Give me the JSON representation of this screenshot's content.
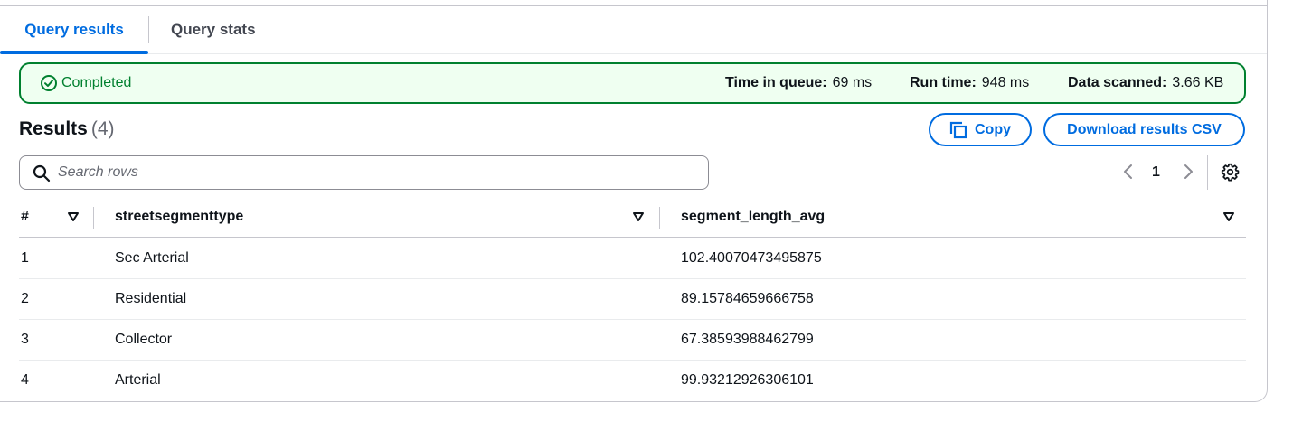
{
  "tabs": [
    {
      "label": "Query results",
      "active": true
    },
    {
      "label": "Query stats",
      "active": false
    }
  ],
  "status": {
    "label": "Completed",
    "icon": "check-circle-icon",
    "color": "#00802f",
    "stats": [
      {
        "label": "Time in queue:",
        "value": "69 ms"
      },
      {
        "label": "Run time:",
        "value": "948 ms"
      },
      {
        "label": "Data scanned:",
        "value": "3.66 KB"
      }
    ]
  },
  "results": {
    "title": "Results",
    "count": "(4)",
    "copy_label": "Copy",
    "download_label": "Download results CSV"
  },
  "search": {
    "placeholder": "Search rows",
    "value": ""
  },
  "pagination": {
    "current_page": "1"
  },
  "table": {
    "columns": [
      "#",
      "streetsegmenttype",
      "segment_length_avg"
    ],
    "rows": [
      [
        "1",
        "Sec Arterial",
        "102.40070473495875"
      ],
      [
        "2",
        "Residential",
        "89.15784659666758"
      ],
      [
        "3",
        "Collector",
        "67.38593988462799"
      ],
      [
        "4",
        "Arterial",
        "99.93212926306101"
      ]
    ]
  },
  "colors": {
    "accent": "#006ce0",
    "success": "#00802f",
    "success_bg": "#effff1"
  }
}
